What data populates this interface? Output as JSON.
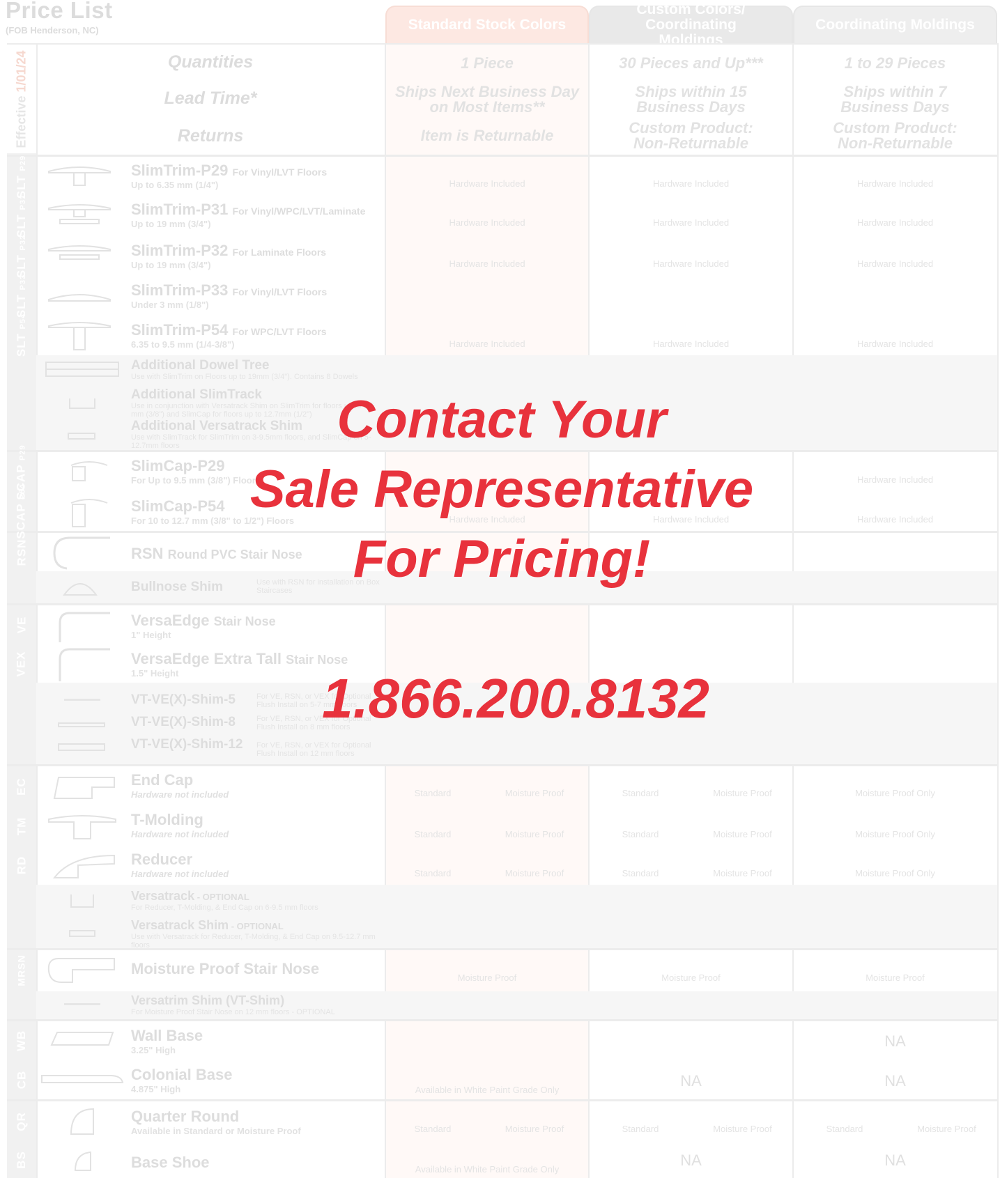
{
  "header": {
    "title": "Price List",
    "fob": "(FOB Henderson, NC)",
    "effective": "Effective",
    "effective_date": "1/01/24",
    "columns": [
      "Standard Stock Colors",
      "Custom Colors/ Coordinating Moldings",
      "Coordinating Moldings"
    ]
  },
  "info_rows": {
    "labels": [
      "Quantities",
      "Lead Time*",
      "Returns"
    ],
    "col1": [
      "1 Piece",
      "Ships Next Business Day on Most Items**",
      "Item is Returnable"
    ],
    "col2": [
      "30 Pieces and Up***",
      "Ships within 15 Business Days",
      "Custom Product: Non-Returnable"
    ],
    "col3": [
      "1 to 29 Pieces",
      "Ships within 7 Business Days",
      "Custom Product: Non-Returnable"
    ]
  },
  "side_tags": {
    "slt": "SLT",
    "p29": "P29",
    "p31": "P31",
    "p32": "P32",
    "p33": "P33",
    "p54": "P54",
    "scap": "SCAP",
    "rsn": "RSN",
    "ve": "VE",
    "vex": "VEX",
    "ec": "EC",
    "tm": "TM",
    "rd": "RD",
    "mrsn": "MRSN",
    "wb": "WB",
    "cb": "CB",
    "qr": "QR",
    "bs": "BS"
  },
  "products": {
    "p29": {
      "name": "SlimTrim-P29",
      "sub": "For Vinyl/LVT Floors",
      "desc": "Up to 6.35 mm (1/4\")"
    },
    "p31": {
      "name": "SlimTrim-P31",
      "sub": "For Vinyl/WPC/LVT/Laminate",
      "desc": "Up to 19 mm (3/4\")"
    },
    "p32": {
      "name": "SlimTrim-P32",
      "sub": "For Laminate Floors",
      "desc": "Up to 19 mm (3/4\")"
    },
    "p33": {
      "name": "SlimTrim-P33",
      "sub": "For Vinyl/LVT Floors",
      "desc": "Under 3 mm (1/8\")"
    },
    "p54": {
      "name": "SlimTrim-P54",
      "sub": "For WPC/LVT Floors",
      "desc": "6.35 to 9.5 mm (1/4-3/8\")"
    },
    "dowel": {
      "name": "Additional Dowel Tree",
      "note": "Use with SlimTrim on Floors up to 19mm (3/4\"). Contains 8 Dowels"
    },
    "track": {
      "name": "Additional SlimTrack",
      "note": "Use in conjunction with Versatrack Shim on SlimTrim for floors up to 9.5 mm (3/8\") and SlimCap for floors up to 12.7mm (1/2\")"
    },
    "vshim": {
      "name": "Additional Versatrack Shim",
      "note": "Use with SlimTrack for SlimTrim on 3-9.5mm floors, and SlimCap on 5-12.7mm floors"
    },
    "scap29": {
      "name": "SlimCap-P29",
      "desc": "For Up to 9.5 mm (3/8\") Floors"
    },
    "scap54": {
      "name": "SlimCap-P54",
      "desc": "For 10 to 12.7 mm (3/8\" to 1/2\") Floors"
    },
    "rsn": {
      "name": "RSN",
      "sub": "Round PVC Stair Nose"
    },
    "bullnose": {
      "name": "Bullnose Shim",
      "note": "Use with RSN for installation on Box Staircases"
    },
    "ve": {
      "name": "VersaEdge",
      "sub": "Stair Nose",
      "desc": "1\" Height"
    },
    "vex": {
      "name": "VersaEdge Extra Tall",
      "sub": "Stair Nose",
      "desc": "1.5\" Height"
    },
    "shim5": {
      "name": "VT-VE(X)-Shim-5",
      "note": "For VE, RSN, or VEX for Optional Flush Install on 5-7 mm floors"
    },
    "shim8": {
      "name": "VT-VE(X)-Shim-8",
      "note": "For VE, RSN, or VEX for Optional Flush Install on 8 mm floors"
    },
    "shim12": {
      "name": "VT-VE(X)-Shim-12",
      "note": "For VE, RSN, or VEX for Optional Flush Install on 12 mm floors"
    },
    "ec": {
      "name": "End Cap",
      "desc": "Hardware not included"
    },
    "tm": {
      "name": "T-Molding",
      "desc": "Hardware not included"
    },
    "rd": {
      "name": "Reducer",
      "desc": "Hardware not included"
    },
    "vtrack": {
      "name": "Versatrack",
      "opt": " - OPTIONAL",
      "note": "For Reducer, T-Molding, & End Cap on 6-9.5 mm floors"
    },
    "vtshim": {
      "name": "Versatrack Shim",
      "opt": " - OPTIONAL",
      "note": "Use with Versatrack for Reducer, T-Molding, & End Cap on 9.5-12.7 mm floors"
    },
    "mrsn": {
      "name": "Moisture Proof Stair Nose"
    },
    "vtrimshim": {
      "name": "Versatrim Shim (VT-Shim)",
      "note": "For Moisture Proof Stair Nose on 12 mm floors - OPTIONAL"
    },
    "wb": {
      "name": "Wall Base",
      "desc": "3.25\" High"
    },
    "cb": {
      "name": "Colonial Base",
      "desc": "4.875\" High"
    },
    "qr": {
      "name": "Quarter Round",
      "desc": "Available in Standard or Moisture Proof"
    },
    "bs": {
      "name": "Base Shoe"
    }
  },
  "cells": {
    "hardware": "Hardware Included",
    "standard": "Standard",
    "moisture": "Moisture Proof",
    "moisture_only": "Moisture Proof Only",
    "na": "NA",
    "white_paint": "Available in White Paint Grade Only"
  },
  "overlay": {
    "line1": "Contact Your",
    "line2": "Sale Representative",
    "line3": "For Pricing!",
    "phone": "1.866.200.8132"
  },
  "colors": {
    "overlay_red": "#e8323c",
    "faded_gray": "#e0e0e0",
    "accent_peach": "#fde8e2"
  }
}
